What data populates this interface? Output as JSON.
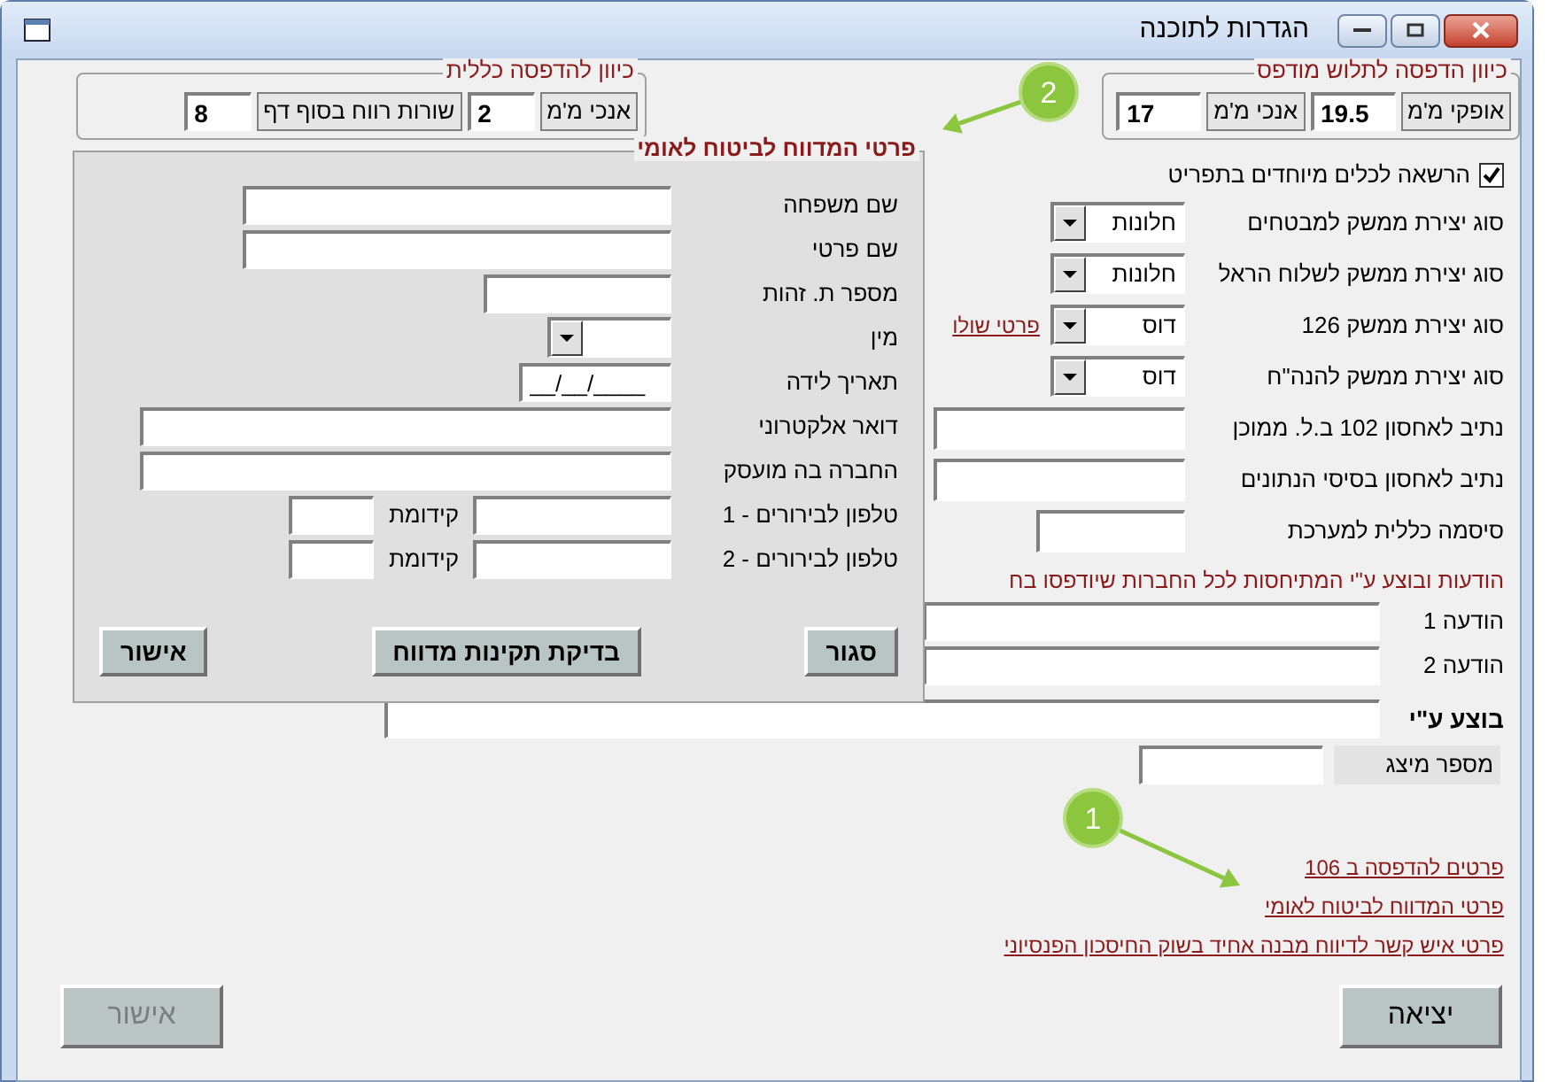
{
  "window": {
    "title": "הגדרות לתוכנה"
  },
  "print_group": {
    "title": "כיוון הדפסה לתלוש מודפס",
    "fields": [
      {
        "label": "אופקי מ'מ",
        "value": "19.5"
      },
      {
        "label": "אנכי מ'מ",
        "value": "17"
      }
    ]
  },
  "general_group": {
    "title": "כיוון להדפסה כללית",
    "fields": [
      {
        "label": "אנכי מ'מ",
        "value": "2"
      },
      {
        "label": "שורות רווח בסוף דף",
        "value": "8"
      }
    ]
  },
  "settings": [
    {
      "kind": "checkbox",
      "label": "הרשאה לכלים מיוחדים בתפריט",
      "checked": true
    },
    {
      "kind": "combo",
      "label": "סוג יצירת ממשק למבטחים",
      "value": "חלונות"
    },
    {
      "kind": "combo",
      "label": "סוג יצירת ממשק לשלוח הראל",
      "value": "חלונות"
    },
    {
      "kind": "combo",
      "label": "סוג יצירת ממשק 126",
      "value": "דוס",
      "link": "פרטי שולו"
    },
    {
      "kind": "combo",
      "label": "סוג יצירת ממשק להנה\"ח",
      "value": "דוס"
    },
    {
      "kind": "text",
      "label": "נתיב לאחסון 102 ב.ל. ממוכן"
    },
    {
      "kind": "text",
      "label": "נתיב לאחסון בסיסי הנתונים"
    },
    {
      "kind": "short",
      "label": "סיסמה כללית למערכת"
    }
  ],
  "messages_heading": "הודעות ובוצע ע\"י המתיחסות לכל החברות שיודפסו בח",
  "messages": [
    {
      "kind": "message",
      "label": "הודעה 1"
    },
    {
      "kind": "message",
      "label": "הודעה 2"
    },
    {
      "kind": "signature",
      "label": "בוצע ע\"י"
    }
  ],
  "display_number": {
    "label": "מספר מיצג"
  },
  "links": [
    "פרטים להדפסה ב 106",
    "פרטי המדווח לביטוח לאומי",
    "פרטי איש קשר לדיווח מבנה אחיד בשוק החיסכון הפנסיוני"
  ],
  "buttons": [
    {
      "label": "יציאה",
      "disabled": false
    },
    {
      "label": "אישור",
      "disabled": true
    }
  ],
  "callouts": [
    {
      "number": "1"
    },
    {
      "number": "2"
    }
  ],
  "reporter_panel": {
    "title": "פרטי המדווח לביטוח לאומי",
    "fields": [
      {
        "kind": "name",
        "label": "שם משפחה"
      },
      {
        "kind": "name",
        "label": "שם פרטי"
      },
      {
        "kind": "id",
        "label": "מספר ת. זהות"
      },
      {
        "kind": "combo",
        "label": "מין"
      },
      {
        "kind": "date",
        "label": "תאריך לידה",
        "value": "__/__/____"
      },
      {
        "kind": "full",
        "label": "דואר אלקטרוני"
      },
      {
        "kind": "full",
        "label": "החברה בה מועסק"
      },
      {
        "kind": "phone",
        "label": "טלפון לבירורים - 1",
        "prefix_label": "קידומת"
      },
      {
        "kind": "phone",
        "label": "טלפון לבירורים - 2",
        "prefix_label": "קידומת"
      }
    ],
    "buttons": [
      "סגור",
      "בדיקת תקינות מדווח",
      "אישור"
    ]
  }
}
